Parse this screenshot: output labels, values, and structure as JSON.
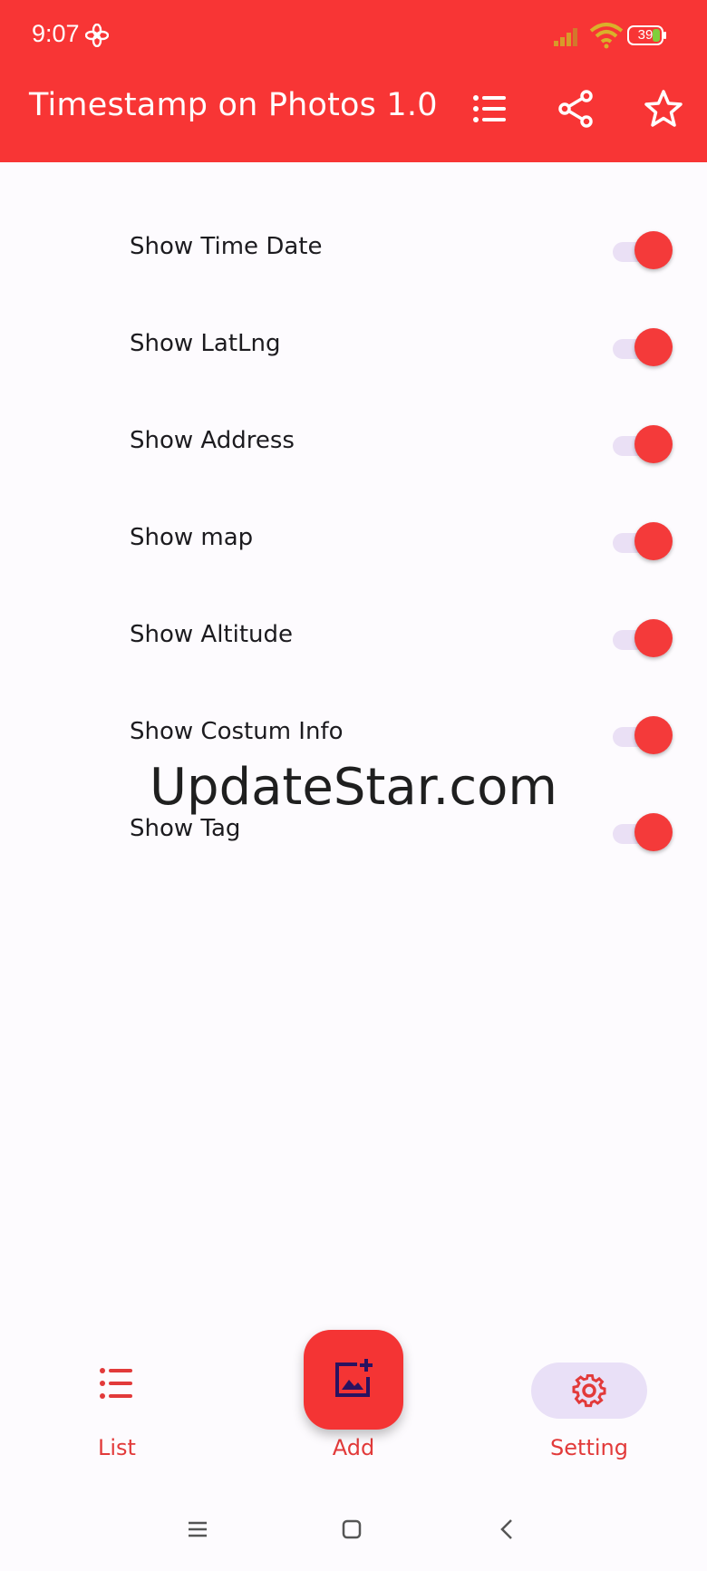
{
  "status_bar": {
    "time": "9:07",
    "battery_level": "39",
    "icons": [
      "fan-icon",
      "signal-icon",
      "wifi-icon",
      "battery-icon"
    ]
  },
  "app_bar": {
    "title": "Timestamp on Photos 1.0",
    "actions": [
      "list-icon",
      "share-icon",
      "star-icon"
    ]
  },
  "settings": {
    "items": [
      {
        "label": "Show Time Date",
        "enabled": true
      },
      {
        "label": "Show LatLng",
        "enabled": true
      },
      {
        "label": "Show Address",
        "enabled": true
      },
      {
        "label": "Show map",
        "enabled": true
      },
      {
        "label": "Show Altitude",
        "enabled": true
      },
      {
        "label": "Show Costum Info",
        "enabled": true
      },
      {
        "label": "Show Tag",
        "enabled": true
      }
    ]
  },
  "watermark": "UpdateStar.com",
  "bottom_nav": {
    "items": [
      {
        "label": "List",
        "icon": "list-icon"
      },
      {
        "label": "Add",
        "icon": "add-photo-icon"
      },
      {
        "label": "Setting",
        "icon": "gear-icon",
        "selected": true
      }
    ]
  },
  "system_nav": [
    "menu-icon",
    "home-icon",
    "back-icon"
  ],
  "colors": {
    "primary": "#f83535",
    "background": "#fdfbfe",
    "switch_track": "#eae0f5",
    "nav_selected_pill": "#e9e0f7",
    "nav_label": "#e23a3a"
  }
}
